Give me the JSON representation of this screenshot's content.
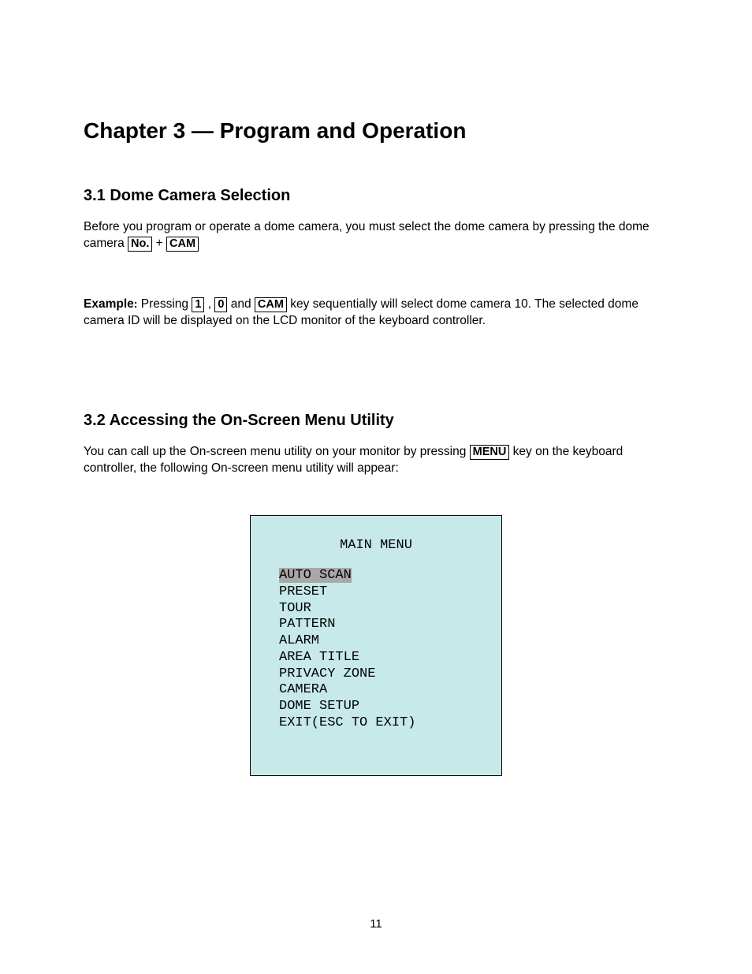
{
  "chapter_title": "Chapter 3 — Program and Operation",
  "section_3_1": {
    "heading": "3.1 Dome Camera Selection",
    "para1_a": "Before you program or operate a dome camera, you must select the dome camera by pressing the dome camera ",
    "key_no": "No.",
    "plus": " + ",
    "key_cam": "CAM",
    "example_label": "Example",
    "example_colon": ":",
    "example_a": " Pressing ",
    "key_1": "1",
    "example_b": " , ",
    "key_0": "0",
    "example_c": " and ",
    "key_cam2": "CAM",
    "example_d": " key sequentially will select dome camera 10. The selected dome camera ID will be displayed on the LCD monitor of the keyboard controller."
  },
  "section_3_2": {
    "heading": "3.2 Accessing the On-Screen Menu Utility",
    "para1_a": "You can call up the On-screen menu utility on your monitor by pressing ",
    "key_menu": "MENU",
    "para1_b": " key on the keyboard controller, the following On-screen menu utility will appear:"
  },
  "menu": {
    "title": "MAIN MENU",
    "highlight": "AUTO SCAN",
    "items": "PRESET\nTOUR\nPATTERN\nALARM\nAREA TITLE\nPRIVACY ZONE\nCAMERA\nDOME SETUP\nEXIT(ESC TO EXIT)"
  },
  "page_number": "11"
}
